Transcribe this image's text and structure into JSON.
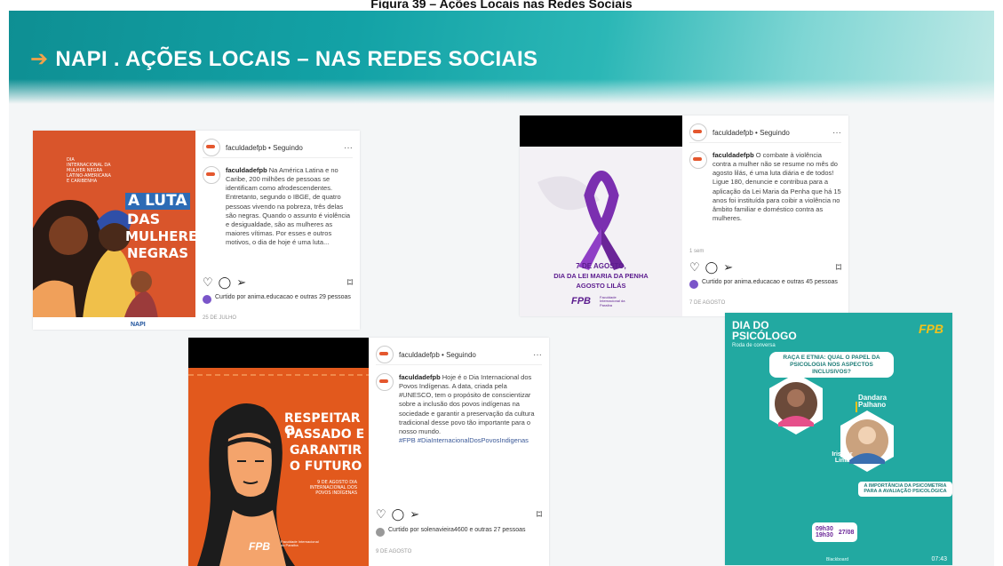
{
  "top_caption": "Figura 39 – Ações Locais nas Redes Sociais",
  "slide": {
    "title_arrow": "➔",
    "title": "NAPI . AÇÕES LOCAIS – NAS REDES SOCIAIS"
  },
  "posts": [
    {
      "username": "faculdadefpb • Seguindo",
      "more": "···",
      "art_small": "DIA INTERNACIONAL DA MULHER NEGRA LATINO-AMERICANA E CARIBENHA",
      "art_title_1": "A LUTA",
      "art_title_2": "DAS",
      "art_title_3": "MULHERES",
      "art_title_4": "NEGRAS",
      "caption_user": "faculdadefpb",
      "caption": "Na América Latina e no Caribe, 200 milhões de pessoas se identificam como afrodescendentes. Entretanto, segundo o IBGE, de quatro pessoas vivendo na pobreza, três delas são negras. Quando o assunto é violência e desigualdade, são as mulheres as maiores vítimas. Por esses e outros motivos, o dia de hoje é uma luta...",
      "liked": "Curtido por anima.educacao e outras 29 pessoas",
      "date": "25 DE JULHO",
      "footer_logo": "NAPI"
    },
    {
      "username": "faculdadefpb • Seguindo",
      "more": "···",
      "art_line_1": "7 DE AGOSTO,",
      "art_line_2": "DIA DA LEI MARIA DA PENHA",
      "art_line_3": "AGOSTO LILÁS",
      "logo": "FPB",
      "logo_sub": "Faculdade Internacional da Paraíba",
      "caption_user": "faculdadefpb",
      "caption": "O combate à violência contra a mulher não se resume no mês do agosto lilás, é uma luta diária e de todos! Ligue 180, denuncie e contribua para a aplicação da Lei Maria da Penha que há 15 anos foi instituída para coibir a violência no âmbito familiar e doméstico contra as mulheres.",
      "ago": "1 sem",
      "liked": "Curtido por anima.educacao e outras 45 pessoas",
      "date": "7 DE AGOSTO"
    },
    {
      "username": "faculdadefpb • Seguindo",
      "more": "···",
      "art_title_1": "RESPEITAR O",
      "art_title_2": "PASSADO E",
      "art_title_3": "GARANTIR",
      "art_title_4": "O FUTURO",
      "art_small": "9 DE AGOSTO DIA INTERNACIONAL DOS POVOS INDÍGENAS",
      "logo": "FPB",
      "logo_sub": "Faculdade Internacional da Paraíba",
      "caption_user": "faculdadefpb",
      "caption": "Hoje é o Dia Internacional dos Povos Indígenas. A data, criada pela #UNESCO, tem o propósito de conscientizar sobre a inclusão dos povos indígenas na sociedade e garantir a preservação da cultura tradicional desse povo tão importante para o nosso mundo.",
      "hashtags": "#FPB #DiaInternacionalDosPovosIndigenas",
      "liked": "Curtido por solenavieira4600 e outras 27 pessoas",
      "date": "9 DE AGOSTO"
    },
    {
      "title_1": "DIA DO",
      "title_2": "PSICÓLOGO",
      "subtitle": "Roda de conversa",
      "logo": "FPB",
      "question": "RAÇA E ETNIA: QUAL O PAPEL DA PSICOLOGIA NOS ASPECTOS INCLUSIVOS?",
      "speaker_1": "Dandara Palhano",
      "speaker_2": "Irismar Lima",
      "topic": "A IMPORTÂNCIA DA PSICOMETRIA PARA A AVALIAÇÃO PSICOLÓGICA",
      "time_1": "09h30",
      "time_2": "19h30",
      "date_label": "27/08",
      "platform": "Blackboard",
      "duration": "07:43"
    }
  ]
}
